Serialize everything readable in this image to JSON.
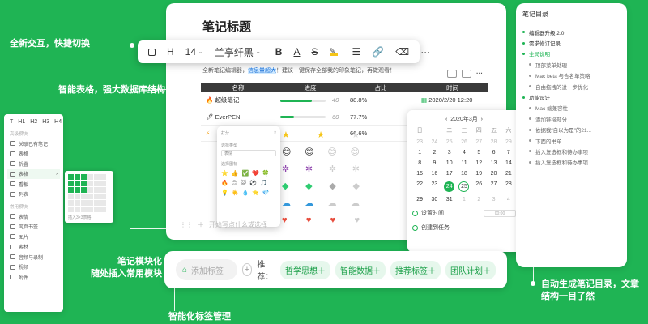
{
  "callouts": {
    "switch": "全新交互，快捷切换",
    "table": "智能表格，强大数据库结构",
    "module_line1": "笔记模块化",
    "module_line2": "随处插入常用模块",
    "tags": "智能化标签管理",
    "toc_line1": "自动生成笔记目录，文章",
    "toc_line2": "结构一目了然"
  },
  "editor": {
    "title": "笔记标题",
    "intro_before": "全新笔记编辑器，",
    "intro_highlight": "信息量超大",
    "intro_after": "！建议一键保存全部我的印象笔记，再做观看！",
    "new_line_placeholder": "开始写点什么或选择"
  },
  "toolbar": {
    "heading": "H",
    "font_size": "14",
    "font_family": "兰亭纤黑",
    "bold": "B",
    "underline": "A",
    "strike": "S"
  },
  "table": {
    "headers": [
      "名称",
      "进度",
      "占比",
      "时间"
    ],
    "rows": [
      {
        "name": "超级笔记",
        "progress": 0.7,
        "progress_label": "40",
        "ratio": "88.8%",
        "time": "2020/2/20 12:20"
      },
      {
        "name": "EverPEN",
        "progress": 0.3,
        "progress_label": "60",
        "ratio": "77.7%",
        "time": ""
      },
      {
        "name": "",
        "progress": 0,
        "progress_label": "",
        "ratio": "66.6%",
        "time": ""
      }
    ]
  },
  "emoji_popup": {
    "title": "打分",
    "style_label": "选择类型",
    "style_value": "表情",
    "icon_label": "选择图标"
  },
  "calendar": {
    "month": "2020年3月",
    "weekdays": [
      "日",
      "一",
      "二",
      "三",
      "四",
      "五",
      "六"
    ],
    "rows": [
      [
        "23",
        "24",
        "25",
        "26",
        "27",
        "28",
        "29"
      ],
      [
        "1",
        "2",
        "3",
        "4",
        "5",
        "6",
        "7"
      ],
      [
        "8",
        "9",
        "10",
        "11",
        "12",
        "13",
        "14"
      ],
      [
        "15",
        "16",
        "17",
        "18",
        "19",
        "20",
        "21"
      ],
      [
        "22",
        "23",
        "24",
        "25",
        "26",
        "27",
        "28"
      ],
      [
        "29",
        "30",
        "31",
        "1",
        "2",
        "3",
        "4"
      ]
    ],
    "selected": "24",
    "set_time_label": "设置时间",
    "time_placeholder": "00:00",
    "create_task_label": "创建到任务"
  },
  "tags": {
    "input_placeholder": "添加标签",
    "recommend_label": "推荐：",
    "items": [
      "哲学思想＋",
      "智能数据＋",
      "推荐标签＋",
      "团队计划＋"
    ]
  },
  "palette": {
    "headings": [
      "T",
      "H1",
      "H2",
      "H3",
      "H4"
    ],
    "group1": "高级模块",
    "group1_items": [
      "关联已有笔记",
      "表格",
      "折叠",
      "表格",
      "看板",
      "列表"
    ],
    "group2": "常用模块",
    "group2_items": [
      "表情",
      "网页书签",
      "图片",
      "素材",
      "音频与录制",
      "视频",
      "附件"
    ],
    "table_picker_caption": "插入3×3表格"
  },
  "toc": {
    "title": "笔记目录",
    "items": [
      {
        "text": "编辑器升级 2.0",
        "level": 1
      },
      {
        "text": "需求修订记录",
        "level": 1
      },
      {
        "text": "全局说明",
        "level": 1,
        "active": true
      },
      {
        "text": "顶部菜单处理",
        "level": 2
      },
      {
        "text": "Mac beta 与合名单策略",
        "level": 2
      },
      {
        "text": "自由拖拽的进一步优化",
        "level": 2
      },
      {
        "text": "功能设计",
        "level": 1
      },
      {
        "text": "Mac 端兼容性",
        "level": 2
      },
      {
        "text": "添加链接部分",
        "level": 2
      },
      {
        "text": "依据我“自以为是”的21...",
        "level": 2
      },
      {
        "text": "下面的书单",
        "level": 2
      },
      {
        "text": "插入复选框和待办事项",
        "level": 2
      },
      {
        "text": "插入复选框和待办事项",
        "level": 2
      }
    ]
  },
  "colors": {
    "brand": "#1fb454",
    "dark_header": "#3a3a3a"
  }
}
